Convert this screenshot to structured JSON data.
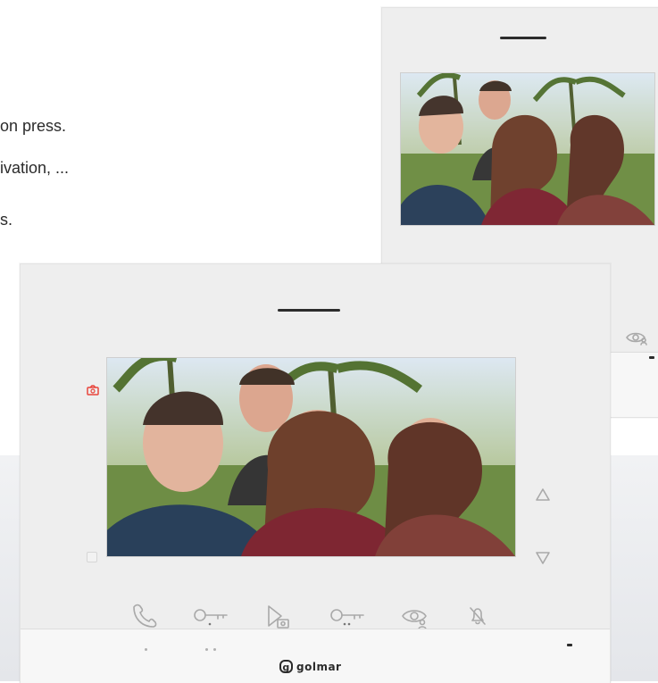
{
  "text": {
    "line1": "on press.",
    "line2": "ivation, ...",
    "line3": "s."
  },
  "brand": {
    "mark": "g",
    "name": "golmar"
  },
  "colors": {
    "monitor_body": "#eeeeee",
    "icon_stroke": "#a9a9a9",
    "accent_red": "#e8453c",
    "text": "#2b2b2b"
  },
  "icons": {
    "top_monitor": [
      "down-arrow-icon",
      "up-arrow-icon",
      "handset-icon",
      "key-icon",
      "eye-user-icon"
    ],
    "bottom_monitor": [
      "handset-icon",
      "key-one-icon",
      "play-camera-icon",
      "key-two-icon",
      "eye-user-icon",
      "bell-off-icon",
      "up-arrow-icon",
      "down-arrow-icon",
      "camera-icon"
    ]
  }
}
